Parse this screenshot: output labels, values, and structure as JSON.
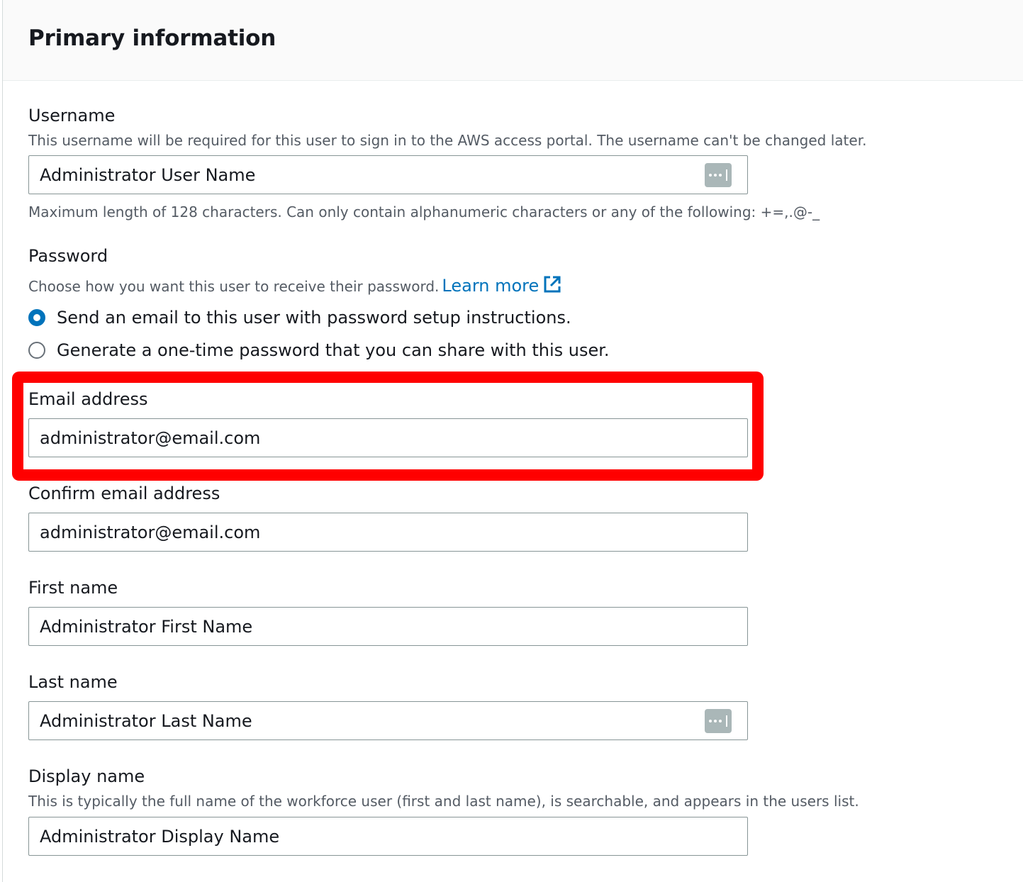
{
  "panel": {
    "title": "Primary information"
  },
  "username": {
    "label": "Username",
    "description": "This username will be required for this user to sign in to the AWS access portal. The username can't be changed later.",
    "value": "Administrator User Name",
    "constraint": "Maximum length of 128 characters. Can only contain alphanumeric characters or any of the following: +=,.@-_"
  },
  "password": {
    "label": "Password",
    "description": "Choose how you want this user to receive their password.",
    "learn_more": "Learn more",
    "options": [
      {
        "label": "Send an email to this user with password setup instructions.",
        "selected": true
      },
      {
        "label": "Generate a one-time password that you can share with this user.",
        "selected": false
      }
    ]
  },
  "email": {
    "label": "Email address",
    "value": "administrator@email.com",
    "highlight_color": "#ff0000"
  },
  "confirm_email": {
    "label": "Confirm email address",
    "value": "administrator@email.com"
  },
  "first_name": {
    "label": "First name",
    "value": "Administrator First Name"
  },
  "last_name": {
    "label": "Last name",
    "value": "Administrator Last Name"
  },
  "display_name": {
    "label": "Display name",
    "description": "This is typically the full name of the workforce user (first and last name), is searchable, and appears in the users list.",
    "value": "Administrator Display Name"
  },
  "icons": {
    "password_manager": "password-manager-icon",
    "external_link": "external-link-icon"
  },
  "colors": {
    "accent": "#0073bb",
    "text": "#16191f",
    "secondary_text": "#545b64",
    "border": "#879596"
  }
}
